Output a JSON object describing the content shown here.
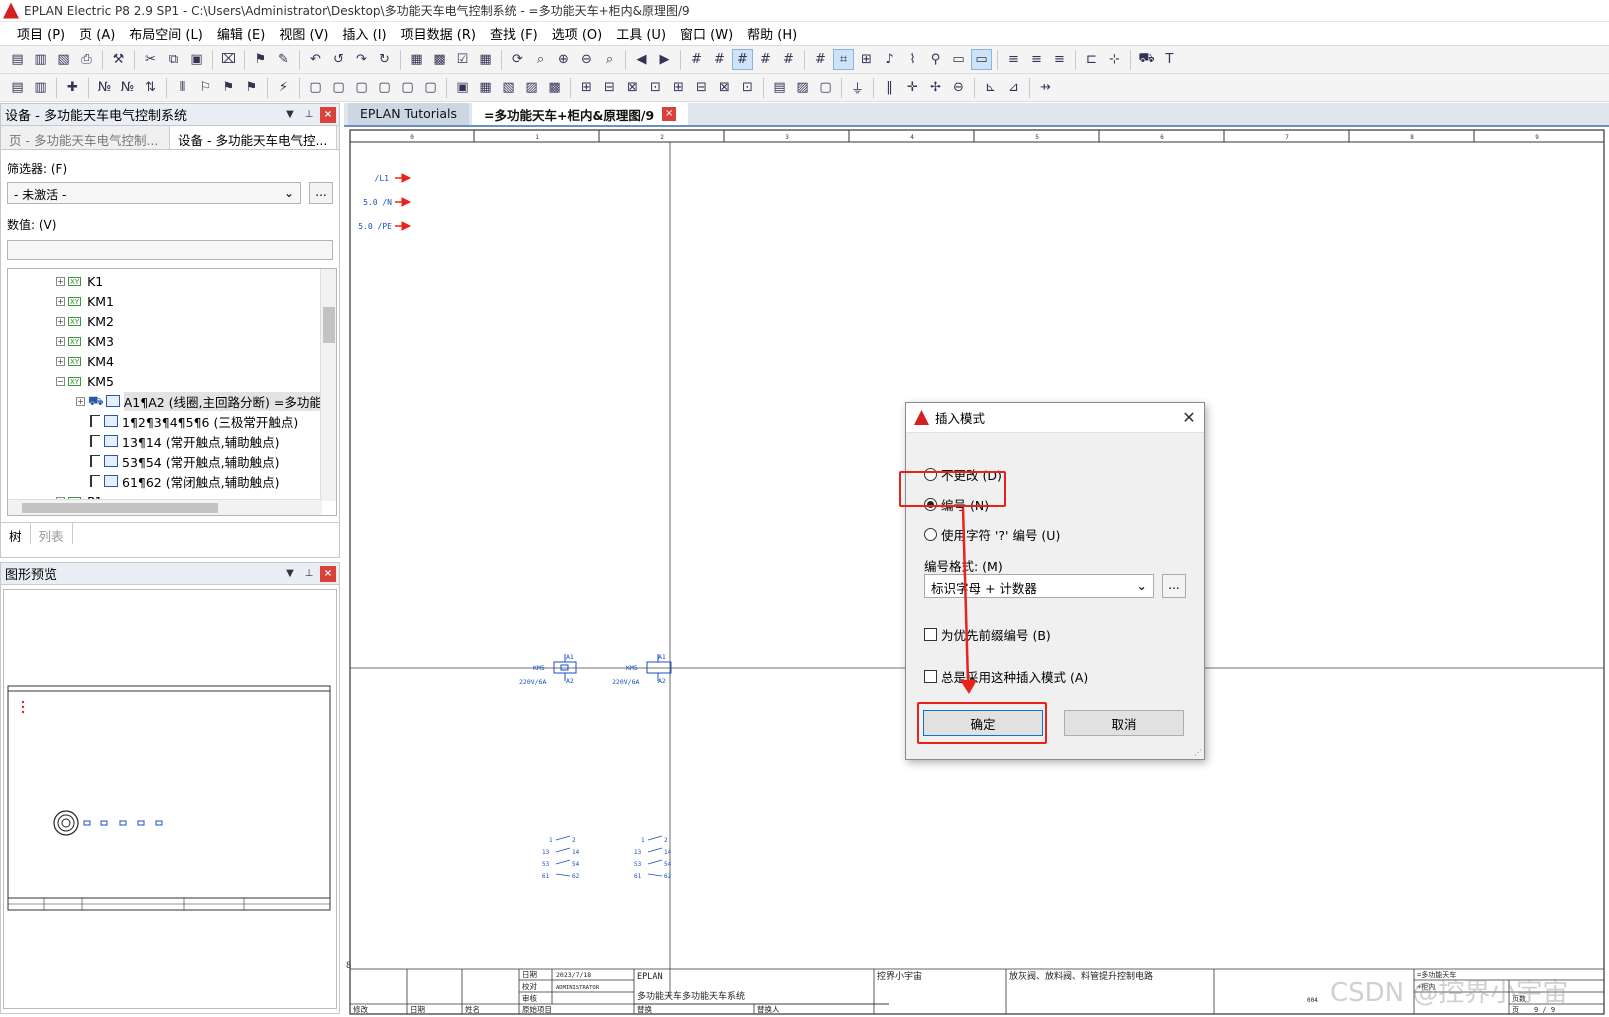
{
  "app": {
    "title": "EPLAN Electric P8 2.9 SP1 - C:\\Users\\Administrator\\Desktop\\多功能天车电气控制系统 - =多功能天车+柜内&原理图/9"
  },
  "menu": [
    "项目 (P)",
    "页 (A)",
    "布局空间 (L)",
    "编辑 (E)",
    "视图 (V)",
    "插入 (I)",
    "项目数据 (R)",
    "查找 (F)",
    "选项 (O)",
    "工具 (U)",
    "窗口 (W)",
    "帮助 (H)"
  ],
  "device_panel": {
    "title": "设备 - 多功能天车电气控制系统",
    "tabs": [
      "页 - 多功能天车电气控制...",
      "设备 - 多功能天车电气控..."
    ],
    "filter_label": "筛选器: (F)",
    "filter_value": "- 未激活 -",
    "filter_button": "...",
    "value_label": "数值: (V)",
    "tree": [
      {
        "label": "K1",
        "kind": "device"
      },
      {
        "label": "KM1",
        "kind": "device"
      },
      {
        "label": "KM2",
        "kind": "device"
      },
      {
        "label": "KM3",
        "kind": "device"
      },
      {
        "label": "KM4",
        "kind": "device"
      },
      {
        "label": "KM5",
        "kind": "device"
      },
      {
        "label": "A1¶A2 (线圈,主回路分断) =多功能天",
        "kind": "part"
      },
      {
        "label": "1¶2¶3¶4¶5¶6 (三极常开触点)",
        "kind": "contact"
      },
      {
        "label": "13¶14 (常开触点,辅助触点)",
        "kind": "contact"
      },
      {
        "label": "53¶54 (常开触点,辅助触点)",
        "kind": "contact"
      },
      {
        "label": "61¶62 (常闭触点,辅助触点)",
        "kind": "contact"
      },
      {
        "label": "P1",
        "kind": "device"
      }
    ],
    "bottom_tabs": [
      "树",
      "列表"
    ]
  },
  "preview_panel": {
    "title": "图形预览"
  },
  "doc_tabs": [
    "EPLAN Tutorials",
    "=多功能天车+柜内&原理图/9"
  ],
  "drawing": {
    "columns": [
      "0",
      "1",
      "2",
      "3",
      "4",
      "5",
      "6",
      "7",
      "8",
      "9"
    ],
    "potentials": [
      "/L1",
      "5.0 /N",
      "5.0 /PE"
    ],
    "coil_label": "KM5",
    "coil_spec": "220V/6A",
    "coil_pins": [
      "A1",
      "A2"
    ],
    "contact_pins": [
      "1",
      "2",
      "13",
      "14",
      "53",
      "54",
      "61",
      "62"
    ],
    "page_row_marker": "8",
    "title_block": {
      "date_label": "日期",
      "date_value": "2023/7/18",
      "editor_label": "校对",
      "editor_value": "ADMINISTRATOR",
      "check_label": "审核",
      "modify_label": "修改",
      "date2_label": "日期",
      "name_label": "姓名",
      "original_label": "原始项目",
      "replace_label": "替换",
      "replaced_by_label": "替换人",
      "company": "EPLAN",
      "project": "多功能天车多功能天车系统",
      "author": "控界小宇宙",
      "page_desc": "放灰阀、放料阀、料管提升控制电路",
      "right_title1": "=多功能天车",
      "right_title2": "+柜内",
      "page_label": "页",
      "page_value": "9 / 9",
      "total_label": "页数",
      "sheet_code": "004"
    }
  },
  "dialog": {
    "title": "插入模式",
    "options": [
      "不更改 (D)",
      "编号 (N)",
      "使用字符 '?' 编号 (U)"
    ],
    "selected": 1,
    "format_label": "编号格式: (M)",
    "format_value": "标识字母 + 计数器",
    "format_button": "...",
    "checks": [
      "为优先前缀编号 (B)",
      "总是采用这种插入模式 (A)"
    ],
    "ok": "确定",
    "cancel": "取消"
  },
  "colors": {
    "annotation": "#e8231b",
    "schematic": "#1b4fc4",
    "potential_arrow": "#e8231b"
  },
  "watermark": "CSDN @控界小宇宙"
}
